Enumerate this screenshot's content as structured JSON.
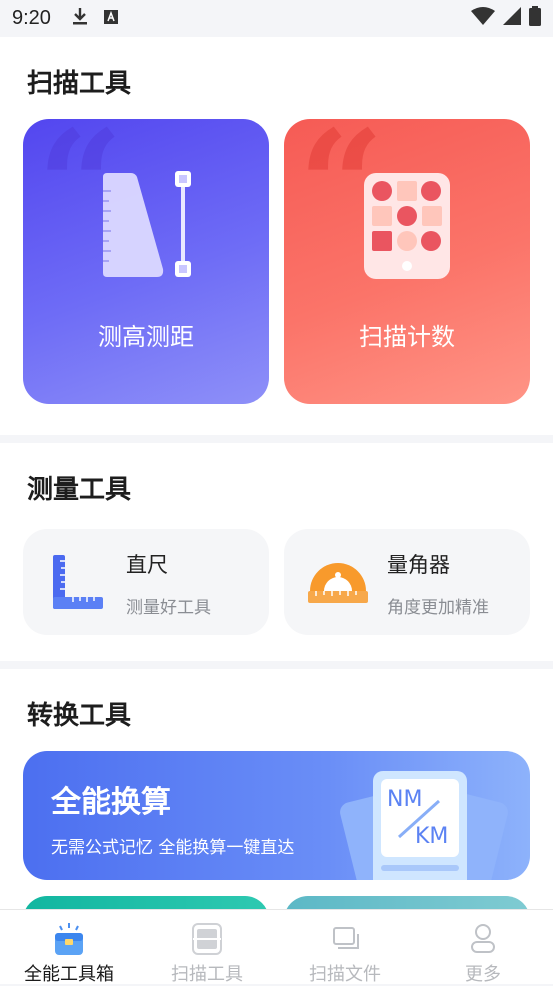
{
  "status_bar": {
    "time": "9:20",
    "download_icon": "download-icon",
    "a_icon": "text-a-icon"
  },
  "scan_section": {
    "title": "扫描工具",
    "cards": [
      {
        "label": "测高测距",
        "icon": "height-distance-icon",
        "color_from": "#5b4ff0",
        "color_to": "#8c8cfa"
      },
      {
        "label": "扫描计数",
        "icon": "count-grid-icon",
        "color_from": "#f7605a",
        "color_to": "#ff8f82"
      }
    ]
  },
  "measure_section": {
    "title": "测量工具",
    "items": [
      {
        "title": "直尺",
        "subtitle": "测量好工具",
        "icon": "ruler-icon"
      },
      {
        "title": "量角器",
        "subtitle": "角度更加精准",
        "icon": "protractor-icon"
      }
    ]
  },
  "convert_section": {
    "title": "转换工具",
    "banner": {
      "title": "全能换算",
      "subtitle": "无需公式记忆 全能换算一键直达",
      "tag_top": "NM",
      "tag_bottom": "KM"
    }
  },
  "tabbar": {
    "tabs": [
      {
        "label": "全能工具箱",
        "icon": "toolbox-icon",
        "active": true
      },
      {
        "label": "扫描工具",
        "icon": "scan-icon",
        "active": false
      },
      {
        "label": "扫描文件",
        "icon": "folder-icon",
        "active": false
      },
      {
        "label": "更多",
        "icon": "user-icon",
        "active": false
      }
    ]
  }
}
